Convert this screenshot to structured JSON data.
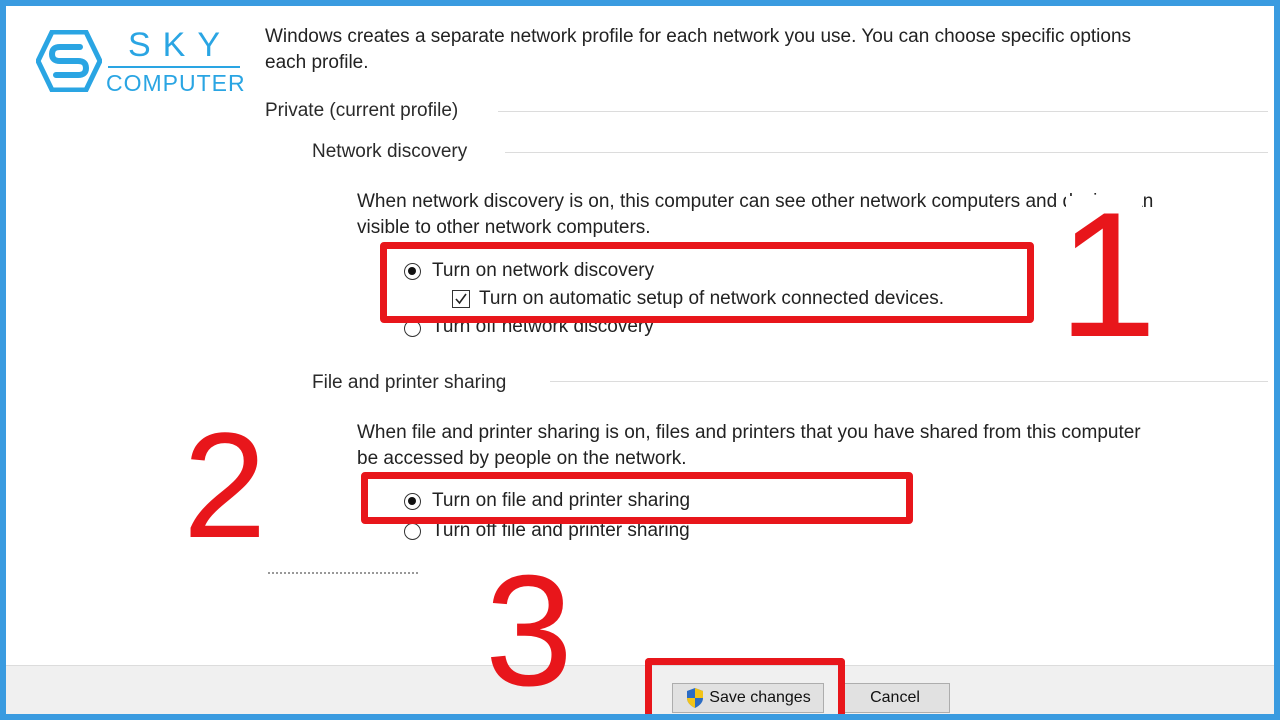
{
  "logo": {
    "line1": "SKY",
    "line2": "COMPUTER",
    "color": "#2aa5e3"
  },
  "intro": {
    "line1": "Windows creates a separate network profile for each network you use. You can choose specific options",
    "line2": "each profile."
  },
  "profile": {
    "label": "Private (current profile)"
  },
  "network_discovery": {
    "label": "Network discovery",
    "desc_line1": "When network discovery is on, this computer can see other network computers and devices an",
    "desc_line2": "visible to other network computers.",
    "option_on": "Turn on network discovery",
    "auto_setup": "Turn on automatic setup of network connected devices.",
    "option_off": "Turn off network discovery",
    "selected": "on",
    "auto_setup_checked": true
  },
  "file_sharing": {
    "label": "File and printer sharing",
    "desc_line1": "When file and printer sharing is on, files and printers that you have shared from this computer",
    "desc_line2": "be accessed by people on the network.",
    "option_on": "Turn on file and printer sharing",
    "option_off": "Turn off file and printer sharing",
    "selected": "on"
  },
  "steps": [
    "1",
    "2",
    "3"
  ],
  "buttons": {
    "save": "Save changes",
    "cancel": "Cancel"
  },
  "colors": {
    "highlight": "#e8161b",
    "frame": "#3a9be0",
    "shield_blue": "#2b6cc4",
    "shield_yellow": "#f2c318"
  }
}
